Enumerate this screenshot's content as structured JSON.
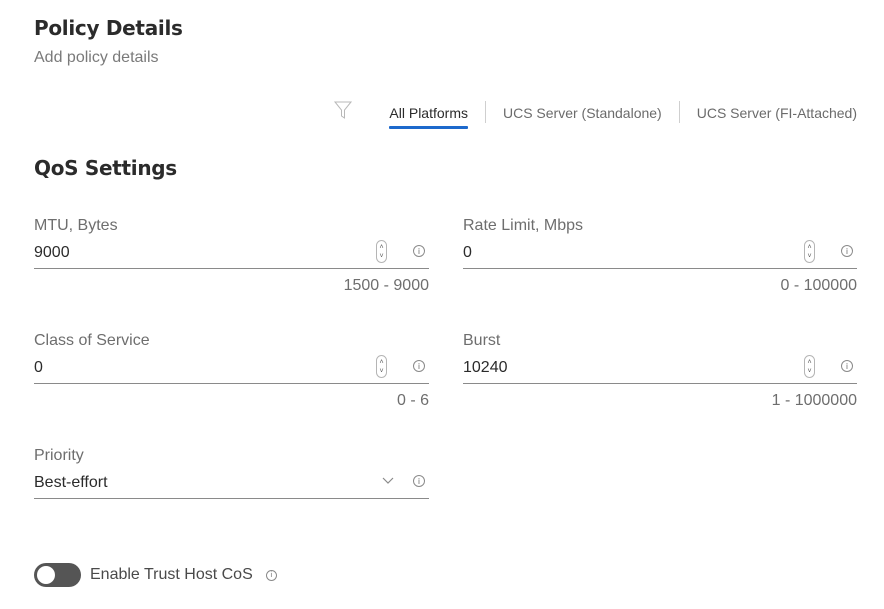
{
  "header": {
    "title": "Policy Details",
    "subtitle": "Add policy details"
  },
  "platform_filter": {
    "icon": "filter-icon",
    "tabs": [
      {
        "label": "All Platforms",
        "active": true
      },
      {
        "label": "UCS Server (Standalone)",
        "active": false
      },
      {
        "label": "UCS Server (FI-Attached)",
        "active": false
      }
    ],
    "accent_color": "#1d69cc"
  },
  "qos": {
    "title": "QoS Settings",
    "fields": {
      "mtu": {
        "label": "MTU, Bytes",
        "value": "9000",
        "range": "1500 - 9000"
      },
      "rate_limit": {
        "label": "Rate Limit, Mbps",
        "value": "0",
        "range": "0 - 100000"
      },
      "class_of_service": {
        "label": "Class of Service",
        "value": "0",
        "range": "0 - 6"
      },
      "burst": {
        "label": "Burst",
        "value": "10240",
        "range": "1 - 1000000"
      },
      "priority": {
        "label": "Priority",
        "value": "Best-effort"
      }
    },
    "stepper_up": "˄",
    "stepper_down": "˅",
    "info_glyph": "i"
  },
  "trust_host_cos": {
    "label": "Enable Trust Host CoS",
    "enabled": false
  }
}
